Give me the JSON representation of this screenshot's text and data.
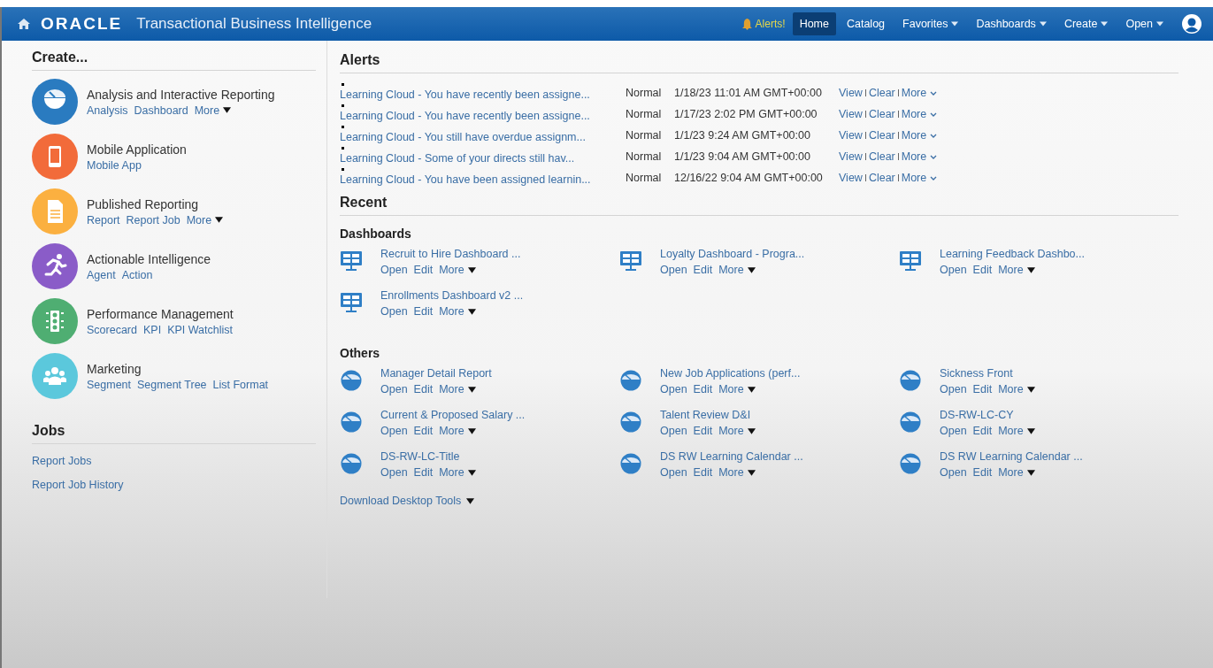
{
  "header": {
    "brand": "ORACLE",
    "product": "Transactional Business Intelligence",
    "alerts_label": "Alerts!",
    "nav": [
      {
        "label": "Home",
        "selected": true,
        "dropdown": false
      },
      {
        "label": "Catalog",
        "selected": false,
        "dropdown": false
      },
      {
        "label": "Favorites",
        "selected": false,
        "dropdown": true
      },
      {
        "label": "Dashboards",
        "selected": false,
        "dropdown": true
      },
      {
        "label": "Create",
        "selected": false,
        "dropdown": true
      },
      {
        "label": "Open",
        "selected": false,
        "dropdown": true
      }
    ]
  },
  "create": {
    "title": "Create...",
    "items": [
      {
        "kind": "analysis",
        "color": "#2a7bc0",
        "title": "Analysis and Interactive Reporting",
        "links": [
          "Analysis",
          "Dashboard"
        ],
        "more": "More"
      },
      {
        "kind": "mobile",
        "color": "#f26b3a",
        "title": "Mobile Application",
        "links": [
          "Mobile App"
        ]
      },
      {
        "kind": "published",
        "color": "#fbb040",
        "title": "Published Reporting",
        "links": [
          "Report",
          "Report Job"
        ],
        "more": "More"
      },
      {
        "kind": "actionable",
        "color": "#8a5cc8",
        "title": "Actionable Intelligence",
        "links": [
          "Agent",
          "Action"
        ]
      },
      {
        "kind": "performance",
        "color": "#4fae72",
        "title": "Performance Management",
        "links": [
          "Scorecard",
          "KPI",
          "KPI Watchlist"
        ]
      },
      {
        "kind": "marketing",
        "color": "#5bc8dc",
        "title": "Marketing",
        "links": [
          "Segment",
          "Segment Tree",
          "List Format"
        ]
      }
    ]
  },
  "jobs": {
    "title": "Jobs",
    "links": [
      "Report Jobs",
      "Report Job History"
    ]
  },
  "alerts": {
    "title": "Alerts",
    "rows": [
      {
        "title": "Learning Cloud - You have recently been assigne...",
        "priority": "Normal",
        "date": "1/18/23 11:01 AM GMT+00:00",
        "actions": [
          "View",
          "Clear",
          "More"
        ]
      },
      {
        "title": "Learning Cloud - You have recently been assigne...",
        "priority": "Normal",
        "date": "1/17/23 2:02 PM GMT+00:00",
        "actions": [
          "View",
          "Clear",
          "More"
        ]
      },
      {
        "title": "Learning Cloud - You still have overdue assignm...",
        "priority": "Normal",
        "date": "1/1/23 9:24 AM GMT+00:00",
        "actions": [
          "View",
          "Clear",
          "More"
        ]
      },
      {
        "title": "Learning Cloud - Some of your directs still hav...",
        "priority": "Normal",
        "date": "1/1/23 9:04 AM GMT+00:00",
        "actions": [
          "View",
          "Clear",
          "More"
        ]
      },
      {
        "title": "Learning Cloud - You have been assigned learnin...",
        "priority": "Normal",
        "date": "12/16/22 9:04 AM GMT+00:00",
        "actions": [
          "View",
          "Clear",
          "More"
        ]
      }
    ]
  },
  "recent": {
    "title": "Recent",
    "sections": [
      {
        "title": "Dashboards",
        "kind": "dashboard",
        "items": [
          {
            "title": "Recruit to Hire Dashboard ...",
            "links": [
              "Open",
              "Edit"
            ],
            "more": "More"
          },
          {
            "title": "Loyalty Dashboard - Progra...",
            "links": [
              "Open",
              "Edit"
            ],
            "more": "More"
          },
          {
            "title": "Learning Feedback Dashbo...",
            "links": [
              "Open",
              "Edit"
            ],
            "more": "More"
          },
          {
            "title": "Enrollments Dashboard v2 ...",
            "links": [
              "Open",
              "Edit"
            ],
            "more": "More"
          }
        ]
      },
      {
        "title": "Others",
        "kind": "analysis",
        "items": [
          {
            "title": "Manager Detail Report",
            "links": [
              "Open",
              "Edit"
            ],
            "more": "More"
          },
          {
            "title": "New Job Applications (perf...",
            "links": [
              "Open",
              "Edit"
            ],
            "more": "More"
          },
          {
            "title": "Sickness Front",
            "links": [
              "Open",
              "Edit"
            ],
            "more": "More"
          },
          {
            "title": "Current & Proposed Salary ...",
            "links": [
              "Open",
              "Edit"
            ],
            "more": "More"
          },
          {
            "title": "Talent Review D&I",
            "links": [
              "Open",
              "Edit"
            ],
            "more": "More"
          },
          {
            "title": "DS-RW-LC-CY",
            "links": [
              "Open",
              "Edit"
            ],
            "more": "More"
          },
          {
            "title": "DS-RW-LC-Title",
            "links": [
              "Open",
              "Edit"
            ],
            "more": "More"
          },
          {
            "title": "DS RW Learning Calendar ...",
            "links": [
              "Open",
              "Edit"
            ],
            "more": "More"
          },
          {
            "title": "DS RW Learning Calendar ...",
            "links": [
              "Open",
              "Edit"
            ],
            "more": "More"
          }
        ]
      }
    ]
  },
  "download": "Download Desktop Tools"
}
